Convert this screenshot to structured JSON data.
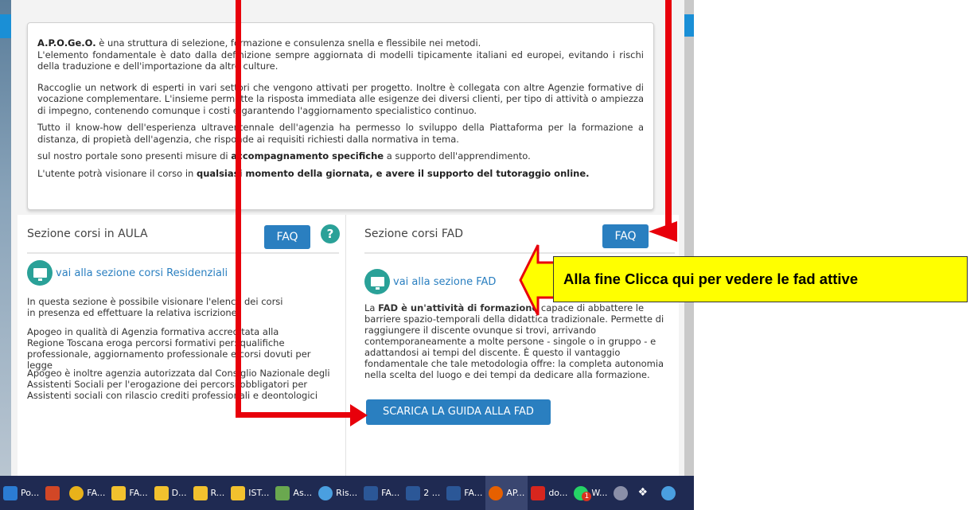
{
  "intro": {
    "p1_brand": "A.P.O.Ge.O.",
    "p1_text": " è una struttura di selezione, formazione e consulenza snella e flessibile nei metodi.",
    "p2": "L'elemento fondamentale è dato dalla definizione sempre aggiornata di modelli tipicamente italiani ed europei, evitando i rischi della traduzione e dell'importazione da altre culture.",
    "p3": "Raccoglie un network di esperti in vari settori che vengono attivati per progetto. Inoltre è collegata con altre Agenzie formative di vocazione complementare. L'insieme permette la risposta immediata alle esigenze dei diversi clienti, per tipo di attività o ampiezza di impegno, contenendo comunque i costi e garantendo l'aggiornamento specialistico continuo.",
    "p4": "Tutto il know-how dell'esperienza ultraventennale dell'agenzia ha permesso lo sviluppo della Piattaforma per la formazione a distanza, di propietà dell'agenzia,  che risponde ai requisiti richiesti dalla normativa in tema.",
    "p5_a": "sul nostro portale sono presenti misure di ",
    "p5_b": "accompagnamento specifiche",
    "p5_c": " a supporto dell'apprendimento.",
    "p6_a": "L'utente potrà visionare il corso in ",
    "p6_b": "qualsiasi momento della giornata, e avere il supporto del tutoraggio online."
  },
  "aula": {
    "title": "Sezione corsi in AULA",
    "faq_label": "FAQ",
    "help_label": "?",
    "link": "vai alla sezione corsi Residenziali",
    "para1": "In questa sezione è possibile visionare l'elenco dei corsi in presenza ed effettuare la relativa iscrizione.",
    "para2": "Apogeo in qualità di Agenzia formativa accreditata alla Regione Toscana eroga percorsi formativi per: qualifiche professionale, aggiornamento professionale e corsi dovuti per legge",
    "para3": "Apogeo è inoltre agenzia autorizzata dal Consiglio Nazionale degli Assistenti Sociali per l'erogazione dei percorsi obbligatori per Assistenti sociali con rilascio crediti professionali e deontologici"
  },
  "fad": {
    "title": "Sezione corsi FAD",
    "faq_label": "FAQ",
    "link": "vai alla sezione FAD",
    "para_a": "La ",
    "para_b": "FAD è un'attività di formazione",
    "para_c": " capace di abbattere le barriere spazio-temporali della didattica tradizionale. Permette di raggiungere il discente ovunque si trovi, arrivando contemporaneamente a molte persone - singole o in gruppo - e adattandosi ai tempi del discente. È questo il vantaggio fondamentale che tale metodologia offre: la completa autonomia nella scelta del luogo e dei tempi da dedicare alla formazione.",
    "guide_button": "SCARICA LA GUIDA ALLA FAD"
  },
  "callout": "Alla fine Clicca qui per vedere le fad attive",
  "taskbar": [
    {
      "label": "Po...",
      "icon": "powerpoint-app-icon",
      "color": "#2b7cd3"
    },
    {
      "label": "",
      "icon": "powerpoint-icon",
      "color": "#d24726"
    },
    {
      "label": "FA...",
      "icon": "chrome-icon",
      "color": "#e8b21a"
    },
    {
      "label": "FA...",
      "icon": "folder-icon",
      "color": "#f2c12e"
    },
    {
      "label": "D...",
      "icon": "folder-icon",
      "color": "#f2c12e"
    },
    {
      "label": "R...",
      "icon": "folder-icon",
      "color": "#f2c12e"
    },
    {
      "label": "IST...",
      "icon": "folder-icon",
      "color": "#f2c12e"
    },
    {
      "label": "As...",
      "icon": "app-icon",
      "color": "#6aa84f"
    },
    {
      "label": "Ris...",
      "icon": "globe-icon",
      "color": "#4a9fe0"
    },
    {
      "label": "FA...",
      "icon": "word-icon",
      "color": "#2b5797"
    },
    {
      "label": "2 ...",
      "icon": "word-icon",
      "color": "#2b5797"
    },
    {
      "label": "FA...",
      "icon": "word-icon",
      "color": "#2b5797"
    },
    {
      "label": "AP...",
      "icon": "firefox-icon",
      "color": "#e66000"
    },
    {
      "label": "do...",
      "icon": "pdf-icon",
      "color": "#d7261e"
    },
    {
      "label": "W...",
      "icon": "whatsapp-icon",
      "color": "#25d366",
      "badge": "1"
    },
    {
      "label": "",
      "icon": "skype-icon",
      "color": "#8a8fa8"
    },
    {
      "label": "",
      "icon": "dropbox-icon",
      "color": "#ffffff"
    },
    {
      "label": "",
      "icon": "search-icon",
      "color": "#4a9fe0"
    }
  ]
}
